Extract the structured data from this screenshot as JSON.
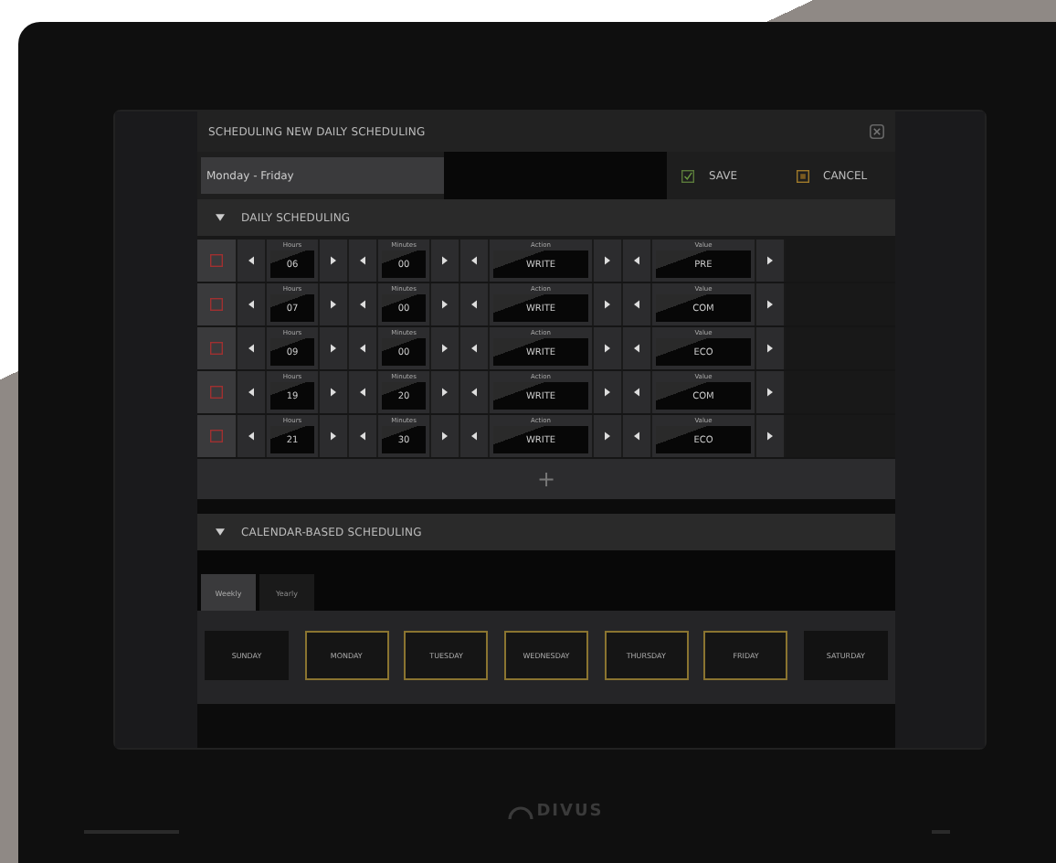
{
  "dialog": {
    "title": "SCHEDULING NEW DAILY SCHEDULING",
    "name_field": {
      "value": "Monday - Friday"
    },
    "save": "SAVE",
    "cancel": "CANCEL"
  },
  "daily_section": {
    "title": "DAILY SCHEDULING",
    "expanded": true,
    "rows": [
      {
        "hours": {
          "label": "Hours",
          "value": "06"
        },
        "minutes": {
          "label": "Minutes",
          "value": "00"
        },
        "action": {
          "label": "Action",
          "value": "WRITE"
        },
        "value": {
          "label": "Value",
          "value": "PRE"
        }
      },
      {
        "hours": {
          "label": "Hours",
          "value": "07"
        },
        "minutes": {
          "label": "Minutes",
          "value": "00"
        },
        "action": {
          "label": "Action",
          "value": "WRITE"
        },
        "value": {
          "label": "Value",
          "value": "COM"
        }
      },
      {
        "hours": {
          "label": "Hours",
          "value": "09"
        },
        "minutes": {
          "label": "Minutes",
          "value": "00"
        },
        "action": {
          "label": "Action",
          "value": "WRITE"
        },
        "value": {
          "label": "Value",
          "value": "ECO"
        }
      },
      {
        "hours": {
          "label": "Hours",
          "value": "19"
        },
        "minutes": {
          "label": "Minutes",
          "value": "20"
        },
        "action": {
          "label": "Action",
          "value": "WRITE"
        },
        "value": {
          "label": "Value",
          "value": "COM"
        }
      },
      {
        "hours": {
          "label": "Hours",
          "value": "21"
        },
        "minutes": {
          "label": "Minutes",
          "value": "30"
        },
        "action": {
          "label": "Action",
          "value": "WRITE"
        },
        "value": {
          "label": "Value",
          "value": "ECO"
        }
      }
    ],
    "add": "+"
  },
  "calendar_section": {
    "title": "CALENDAR-BASED SCHEDULING",
    "expanded": true,
    "tabs": [
      {
        "label": "Weekly",
        "selected": true
      },
      {
        "label": "Yearly",
        "selected": false
      }
    ],
    "days": [
      {
        "label": "SUNDAY",
        "selected": false
      },
      {
        "label": "MONDAY",
        "selected": true
      },
      {
        "label": "TUESDAY",
        "selected": true
      },
      {
        "label": "WEDNESDAY",
        "selected": true
      },
      {
        "label": "THURSDAY",
        "selected": true
      },
      {
        "label": "FRIDAY",
        "selected": true
      },
      {
        "label": "SATURDAY",
        "selected": false
      }
    ]
  },
  "device": {
    "brand": "DIVUS"
  }
}
